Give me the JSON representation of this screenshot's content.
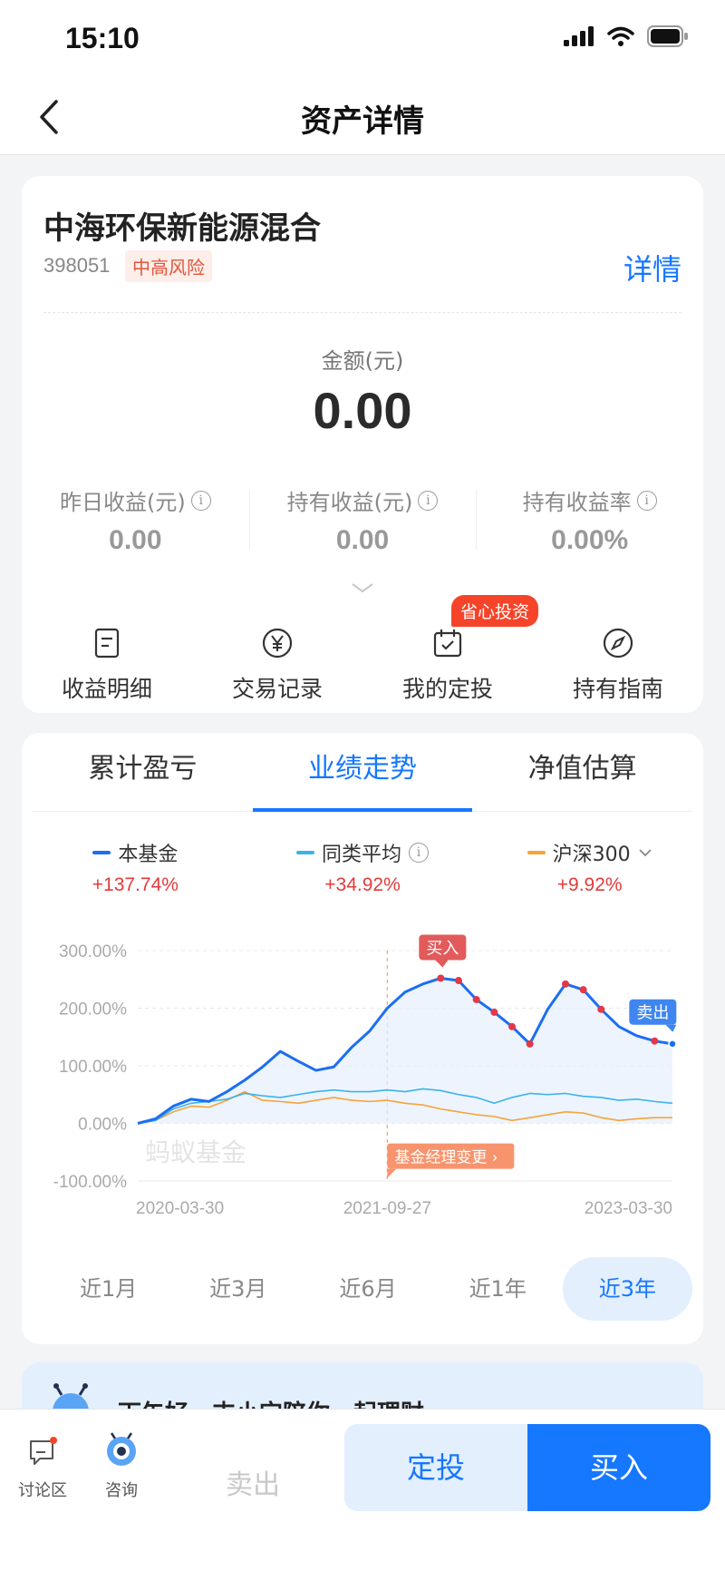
{
  "status_bar": {
    "time": "15:10"
  },
  "nav": {
    "title": "资产详情"
  },
  "fund": {
    "name": "中海环保新能源混合",
    "code": "398051",
    "risk": "中高风险",
    "detail_link": "详情",
    "amount_label": "金额(元)",
    "amount": "0.00",
    "stats": [
      {
        "label": "昨日收益(元)",
        "value": "0.00"
      },
      {
        "label": "持有收益(元)",
        "value": "0.00"
      },
      {
        "label": "持有收益率",
        "value": "0.00%"
      }
    ],
    "promo_badge": "省心投资",
    "actions": [
      {
        "label": "收益明细",
        "icon": "document-icon"
      },
      {
        "label": "交易记录",
        "icon": "yen-coin-icon"
      },
      {
        "label": "我的定投",
        "icon": "calendar-check-icon"
      },
      {
        "label": "持有指南",
        "icon": "compass-icon"
      }
    ]
  },
  "chart_tabs": [
    "累计盈亏",
    "业绩走势",
    "净值估算"
  ],
  "active_chart_tab": 1,
  "legend": [
    {
      "name": "本基金",
      "value": "+137.74%",
      "color": "#1c6ef2"
    },
    {
      "name": "同类平均",
      "value": "+34.92%",
      "color": "#3bb3ea"
    },
    {
      "name": "沪深300",
      "value": "+9.92%",
      "color": "#f5a43a"
    }
  ],
  "chart_data": {
    "type": "line",
    "y_ticks": [
      "300.00%",
      "200.00%",
      "100.00%",
      "0.00%",
      "-100.00%"
    ],
    "ylim": [
      -100,
      300
    ],
    "x_ticks": [
      "2020-03-30",
      "2021-09-27",
      "2023-03-30"
    ],
    "watermark": "蚂蚁基金",
    "annotations": {
      "buy": "买入",
      "sell": "卖出",
      "manager_change": "基金经理变更 ›"
    },
    "series": [
      {
        "name": "本基金",
        "color": "#1c6ef2",
        "values": [
          0,
          8,
          30,
          42,
          38,
          55,
          75,
          98,
          125,
          108,
          92,
          98,
          132,
          160,
          200,
          228,
          242,
          252,
          248,
          215,
          193,
          168,
          138,
          198,
          242,
          232,
          198,
          168,
          152,
          143,
          138
        ]
      },
      {
        "name": "同类平均",
        "color": "#3bb3ea",
        "values": [
          0,
          5,
          25,
          35,
          38,
          42,
          52,
          48,
          45,
          50,
          55,
          58,
          55,
          55,
          58,
          55,
          60,
          57,
          50,
          45,
          35,
          45,
          52,
          50,
          52,
          47,
          45,
          40,
          42,
          38,
          35
        ]
      },
      {
        "name": "沪深300",
        "color": "#f5a43a",
        "values": [
          0,
          5,
          20,
          30,
          28,
          40,
          55,
          40,
          38,
          35,
          40,
          45,
          40,
          38,
          40,
          35,
          32,
          25,
          20,
          15,
          12,
          5,
          10,
          15,
          20,
          18,
          10,
          5,
          8,
          10,
          10
        ]
      }
    ],
    "buy_markers": [
      17,
      18,
      19,
      20,
      21,
      22
    ],
    "sell_markers": [
      24,
      25,
      26,
      29,
      30
    ],
    "manager_change_index": 14
  },
  "periods": [
    "近1月",
    "近3月",
    "近6月",
    "近1年",
    "近3年"
  ],
  "active_period": 4,
  "greeting": "下午好，支小宝陪你一起理财~",
  "bottom": {
    "discuss": "讨论区",
    "consult": "咨询",
    "sell": "卖出",
    "sip": "定投",
    "buy": "买入"
  }
}
